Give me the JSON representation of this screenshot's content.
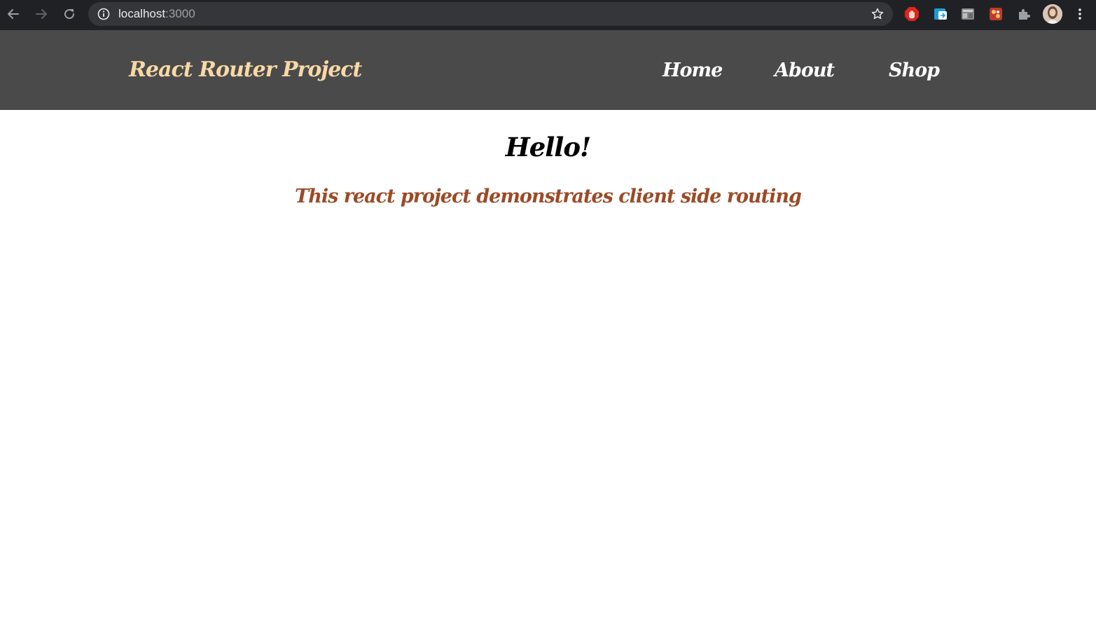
{
  "browser": {
    "url_host": "localhost",
    "url_port": ":3000",
    "icons": {
      "back": "arrow-left-icon",
      "forward": "arrow-right-icon",
      "reload": "reload-icon",
      "info": "info-icon",
      "bookmark": "star-icon",
      "menu": "kebab-menu-icon"
    },
    "extensions": [
      "adblock-icon",
      "translate-icon",
      "screenshot-icon",
      "extension-app-icon",
      "puzzle-icon"
    ]
  },
  "navbar": {
    "brand": "React Router Project",
    "links": [
      {
        "label": "Home"
      },
      {
        "label": "About"
      },
      {
        "label": "Shop"
      }
    ],
    "colors": {
      "background": "#4a4a4a",
      "brand": "#f7d9a6",
      "links": "#ffffff"
    }
  },
  "main": {
    "heading": "Hello!",
    "subtitle": "This react project demonstrates client side routing",
    "colors": {
      "heading": "#000000",
      "subtitle": "#9b4a26"
    }
  }
}
